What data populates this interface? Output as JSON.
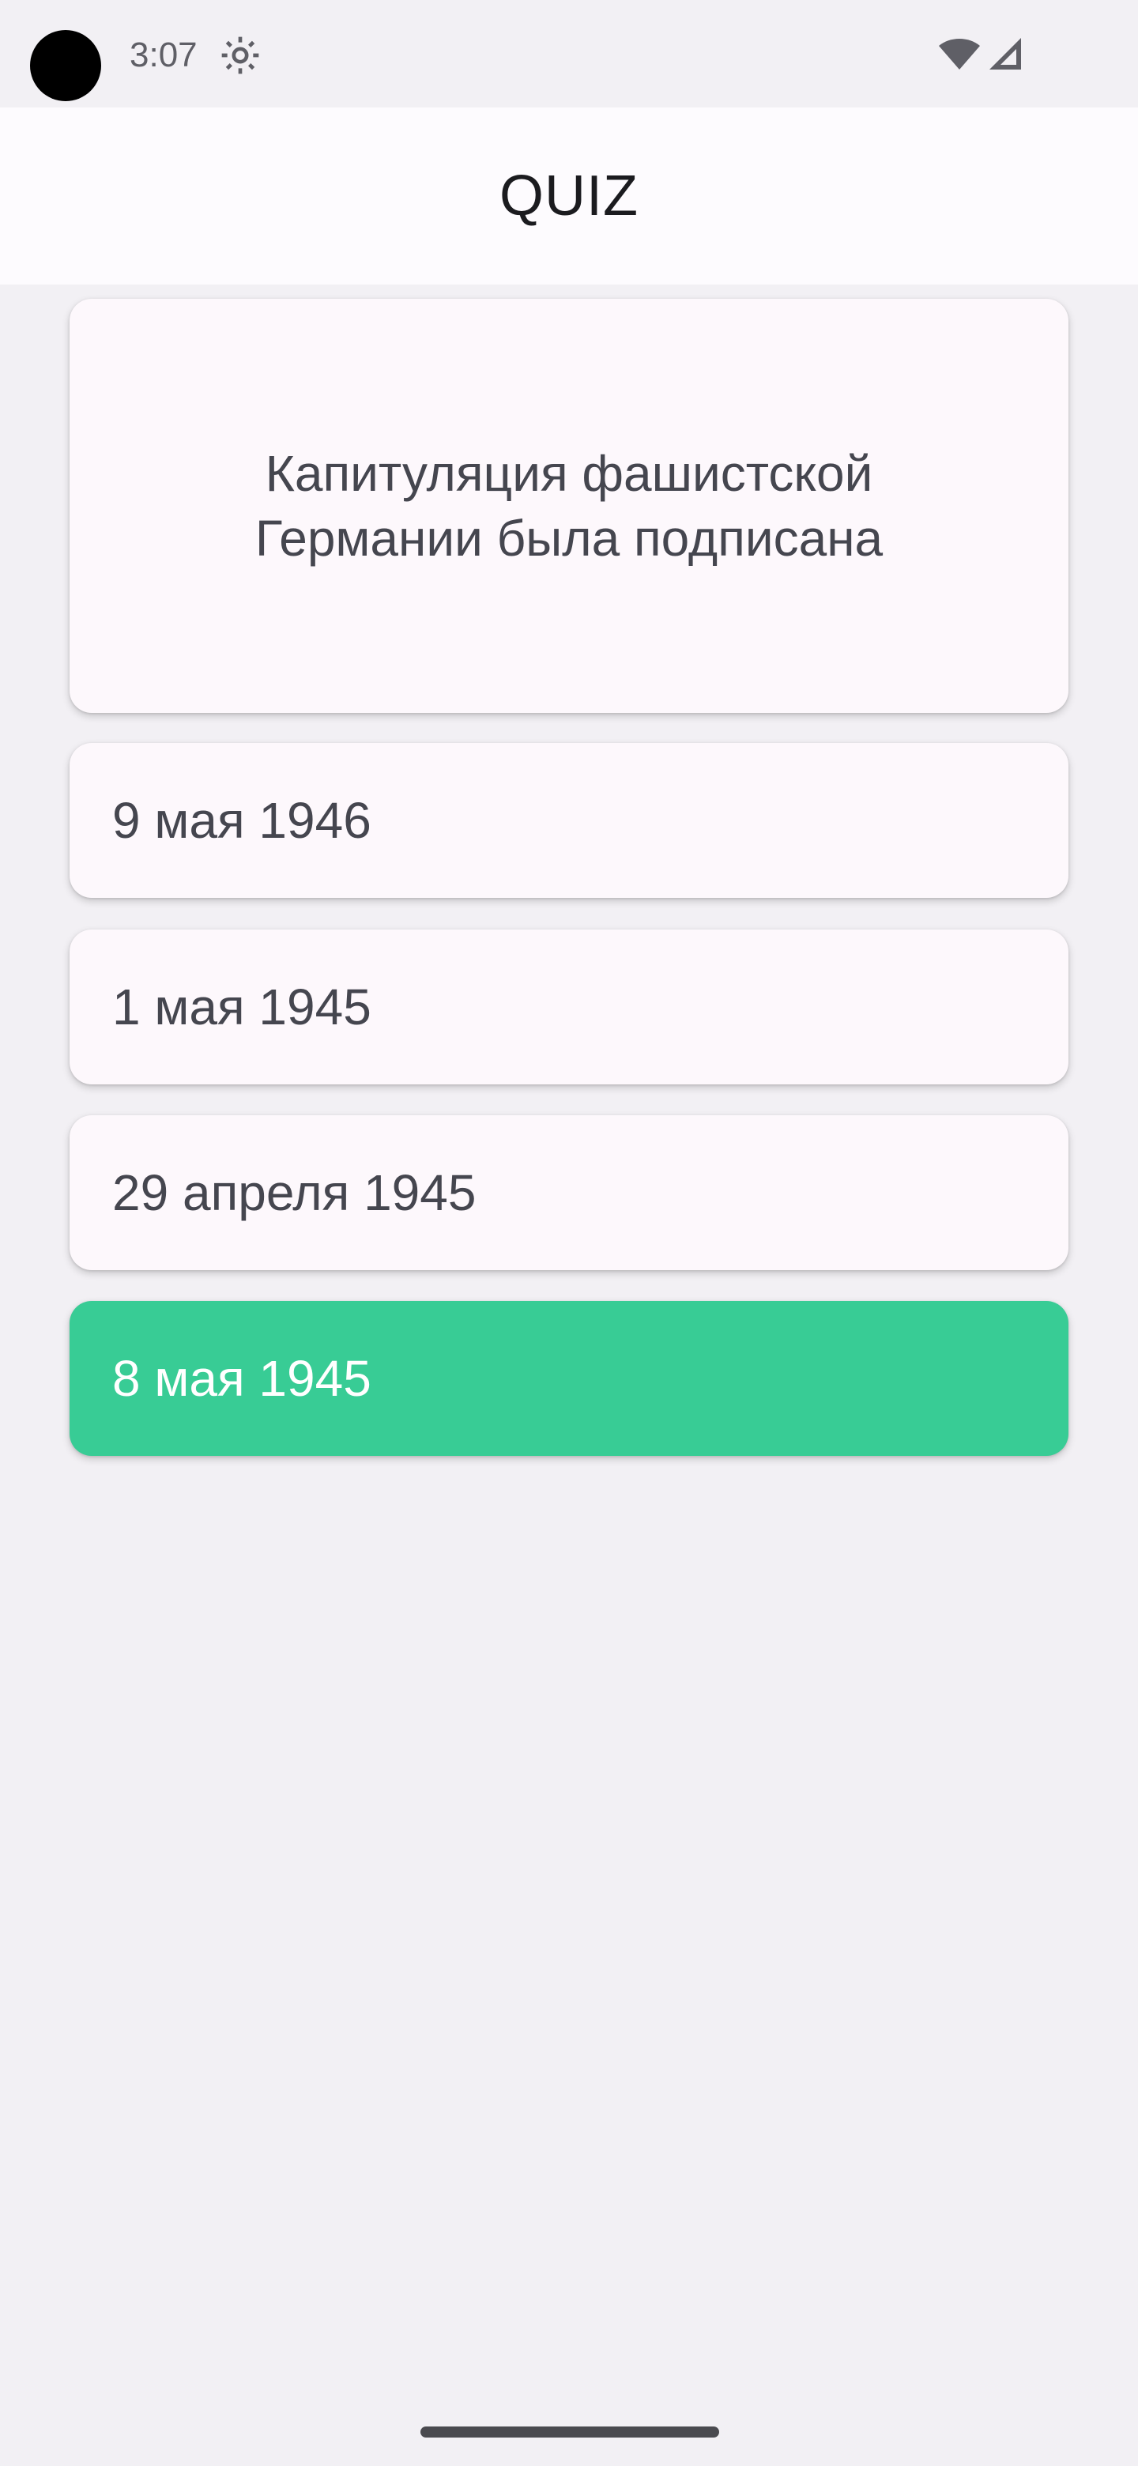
{
  "status_bar": {
    "time": "3:07",
    "icons": [
      "camera-dot",
      "gear-icon",
      "wifi-icon",
      "cell-signal-icon"
    ]
  },
  "app_bar": {
    "title": "QUIZ"
  },
  "question": {
    "text": "Капитуляция фашистской Германии была подписана"
  },
  "answers": [
    {
      "label": "9 мая 1946",
      "state": "default"
    },
    {
      "label": "1 мая 1945",
      "state": "default"
    },
    {
      "label": "29 апреля 1945",
      "state": "default"
    },
    {
      "label": "8 мая 1945",
      "state": "correct"
    }
  ],
  "colors": {
    "background": "#f2f0f4",
    "card": "#fdf8fc",
    "correct": "#38cc95",
    "text": "#45464f"
  }
}
